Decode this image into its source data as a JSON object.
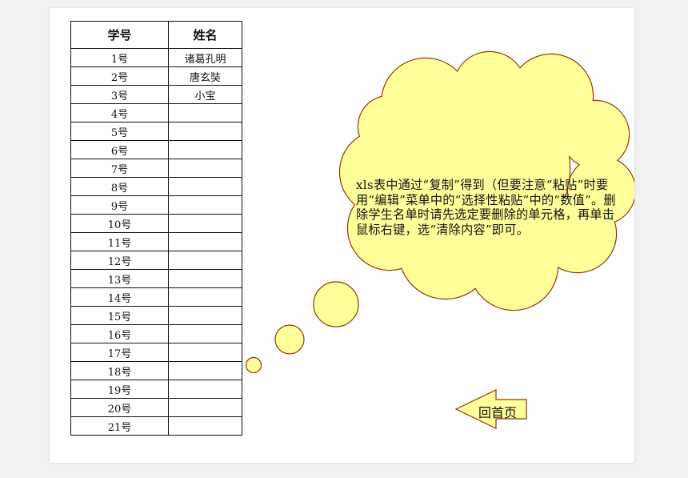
{
  "table": {
    "headers": [
      "学号",
      "姓名"
    ],
    "rows": [
      [
        "1号",
        "诸葛孔明"
      ],
      [
        "2号",
        "唐玄奘"
      ],
      [
        "3号",
        "小宝"
      ],
      [
        "4号",
        ""
      ],
      [
        "5号",
        ""
      ],
      [
        "6号",
        ""
      ],
      [
        "7号",
        ""
      ],
      [
        "8号",
        ""
      ],
      [
        "9号",
        ""
      ],
      [
        "10号",
        ""
      ],
      [
        "11号",
        ""
      ],
      [
        "12号",
        ""
      ],
      [
        "13号",
        ""
      ],
      [
        "14号",
        ""
      ],
      [
        "15号",
        ""
      ],
      [
        "16号",
        ""
      ],
      [
        "17号",
        ""
      ],
      [
        "18号",
        ""
      ],
      [
        "19号",
        ""
      ],
      [
        "20号",
        ""
      ],
      [
        "21号",
        ""
      ]
    ]
  },
  "callout": {
    "text": "xls表中通过“复制”得到（但要注意“粘贴”时要用“编辑”菜单中的“选择性粘贴”中的“数值”。删除学生名单时请先选定要删除的单元格，再单击鼠标右键，选“清除内容”即可。"
  },
  "home_button": {
    "label": "回首页"
  },
  "colors": {
    "cloud_fill": "#ffff99",
    "cloud_stroke": "#993300",
    "arrow_fill": "#ffff99",
    "arrow_stroke": "#993300",
    "grid": "#111111"
  }
}
